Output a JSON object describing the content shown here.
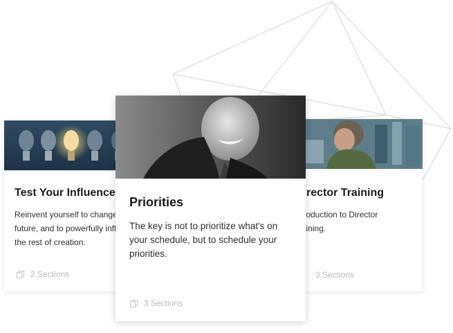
{
  "colors": {
    "line": "#cfd6d8",
    "title": "#1c1c1c",
    "text": "#2e2e2e",
    "muted": "#b9b9b9"
  },
  "cards": {
    "left": {
      "image": "light-bulbs-photo",
      "title": "Test Your Influence",
      "description": "Reinvent yourself to change your future, and to powerfully influence the rest of creation.",
      "sections_icon": "copy-icon",
      "sections": "2 Sections"
    },
    "center": {
      "image": "smiling-man-portrait-photo",
      "title": "Priorities",
      "description": "The key is not to prioritize what's on your schedule, but to schedule your priorities.",
      "sections_icon": "copy-icon",
      "sections": "3 Sections"
    },
    "right": {
      "image": "man-in-office-photo",
      "title": "Director Training",
      "description": "Introduction to Director Training.",
      "sections_icon": "copy-icon",
      "sections": "3 Sections"
    }
  }
}
